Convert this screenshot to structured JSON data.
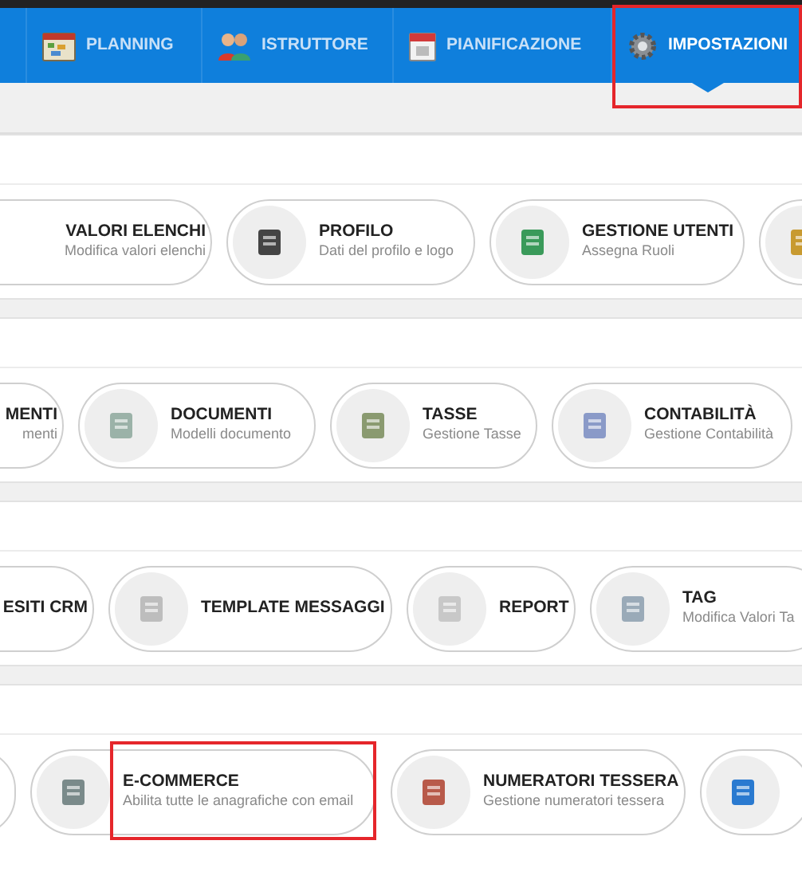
{
  "tabs": [
    {
      "label": "PLANNING",
      "selected": false,
      "highlighted": false
    },
    {
      "label": "ISTRUTTORE",
      "selected": false,
      "highlighted": false
    },
    {
      "label": "PIANIFICAZIONE",
      "selected": false,
      "highlighted": false
    },
    {
      "label": "IMPOSTAZIONI",
      "selected": true,
      "highlighted": true
    }
  ],
  "sections": [
    {
      "items": [
        {
          "kind": "pill",
          "title": "VALORI ELENCHI",
          "subtitle": "Modifica valori elenchi",
          "highlighted": false
        },
        {
          "kind": "pill",
          "title": "PROFILO",
          "subtitle": "Dati del profilo e logo",
          "highlighted": false
        },
        {
          "kind": "pill",
          "title": "GESTIONE UTENTI",
          "subtitle": "Assegna Ruoli",
          "highlighted": false
        },
        {
          "kind": "stub",
          "highlighted": false
        }
      ]
    },
    {
      "items": [
        {
          "kind": "pill",
          "title": "MENTI",
          "subtitle": "menti",
          "highlighted": false
        },
        {
          "kind": "pill",
          "title": "DOCUMENTI",
          "subtitle": "Modelli documento",
          "highlighted": false
        },
        {
          "kind": "pill",
          "title": "TASSE",
          "subtitle": "Gestione Tasse",
          "highlighted": false
        },
        {
          "kind": "pill",
          "title": "CONTABILITÀ",
          "subtitle": "Gestione Contabilità",
          "highlighted": false
        }
      ]
    },
    {
      "items": [
        {
          "kind": "pill",
          "title": "ESITI CRM",
          "highlighted": false
        },
        {
          "kind": "pill",
          "title": "TEMPLATE MESSAGGI",
          "highlighted": false
        },
        {
          "kind": "pill",
          "title": "REPORT",
          "highlighted": false
        },
        {
          "kind": "pill",
          "title": "TAG",
          "subtitle": "Modifica Valori Ta",
          "highlighted": false
        }
      ]
    },
    {
      "items": [
        {
          "kind": "stub",
          "highlighted": false
        },
        {
          "kind": "pill",
          "title": "E-COMMERCE",
          "subtitle": "Abilita tutte le anagrafiche con email",
          "highlighted": true
        },
        {
          "kind": "pill",
          "title": "NUMERATORI TESSERA",
          "subtitle": "Gestione numeratori tessera",
          "highlighted": false
        },
        {
          "kind": "stub",
          "highlighted": false
        }
      ]
    }
  ]
}
